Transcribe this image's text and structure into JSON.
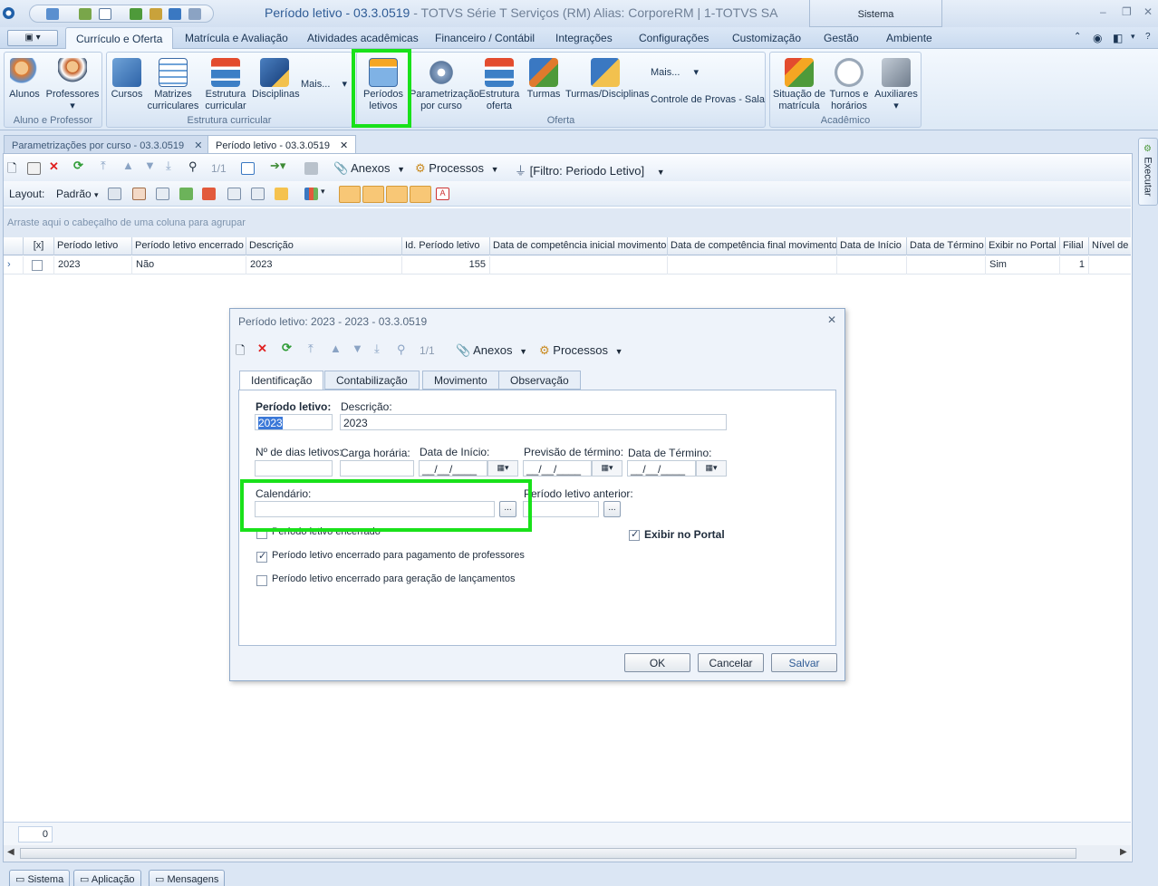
{
  "window": {
    "title": "Período letivo - 03.3.0519",
    "subtitle": " - TOTVS Série T Serviços (RM) Alias: CorporeRM | 1-TOTVS SA",
    "system_tab": "Sistema"
  },
  "menu": [
    "Currículo e Oferta",
    "Matrícula e Avaliação",
    "Atividades acadêmicas",
    "Financeiro / Contábil",
    "Integrações",
    "Configurações",
    "Customização",
    "Gestão",
    "Ambiente"
  ],
  "ribbon": {
    "groups": [
      "Aluno e Professor",
      "Estrutura curricular",
      "Oferta",
      "Acadêmico"
    ],
    "alunos": "Alunos",
    "professores": "Professores",
    "cursos": "Cursos",
    "matrizes": [
      "Matrizes",
      "curriculares"
    ],
    "estrutura": [
      "Estrutura",
      "curricular"
    ],
    "disciplinas": "Disciplinas",
    "mais1": "Mais...",
    "periodos": [
      "Períodos",
      "letivos"
    ],
    "parametrizacao": [
      "Parametrização",
      "por curso"
    ],
    "estrutura_oferta": [
      "Estrutura",
      "oferta"
    ],
    "turmas": "Turmas",
    "turmas_disciplinas": "Turmas/Disciplinas",
    "mais2": "Mais...",
    "controle": "Controle de Provas - Sala",
    "situacao": [
      "Situação de",
      "matrícula"
    ],
    "turnos": [
      "Turnos e",
      "horários"
    ],
    "auxiliares": "Auxiliares"
  },
  "doc_tabs": [
    "Parametrizações por curso - 03.3.0519",
    "Período letivo - 03.3.0519"
  ],
  "toolbar": {
    "nav_count": "1/1",
    "anexos": "Anexos",
    "processos": "Processos",
    "filter": "[Filtro: Periodo Letivo]",
    "layout_label": "Layout:",
    "layout_value": "Padrão"
  },
  "grid": {
    "group_hint": "Arraste aqui o cabeçalho de uma coluna para agrupar",
    "headers": [
      "[x]",
      "Período letivo",
      "Período letivo encerrado",
      "Descrição",
      "Id. Período letivo",
      "Data de competência inicial movimento",
      "Data de competência final movimento",
      "Data de Início",
      "Data de Término",
      "Exibir no Portal",
      "Filial",
      "Nível de"
    ],
    "row": {
      "periodo": "2023",
      "encerrado": "Não",
      "descricao": "2023",
      "id": "155",
      "exibir": "Sim",
      "filial": "1"
    },
    "footer_count": "0"
  },
  "exec_label": "Executar",
  "statusbar": [
    "Sistema",
    "Aplicação",
    "Mensagens"
  ],
  "dialog": {
    "title": "Período letivo: 2023 - 2023 - 03.3.0519",
    "nav_count": "1/1",
    "anexos": "Anexos",
    "processos": "Processos",
    "tabs": [
      "Identificação",
      "Contabilização",
      "Movimento",
      "Observação"
    ],
    "labels": {
      "periodo": "Período letivo:",
      "descricao": "Descrição:",
      "dias": "Nº de dias letivos:",
      "carga": "Carga horária:",
      "inicio": "Data de Início:",
      "previsao": "Previsão de término:",
      "termino": "Data de Término:",
      "calendario": "Calendário:",
      "anterior": "Período letivo anterior:",
      "encerrado": "Período letivo encerrado",
      "encerrado_pag": "Período letivo encerrado para pagamento de professores",
      "encerrado_lanc": "Período letivo encerrado para geração de lançamentos",
      "exibir": "Exibir no Portal"
    },
    "values": {
      "periodo": "2023",
      "descricao": "2023",
      "date_mask": "__/__/____"
    },
    "buttons": {
      "ok": "OK",
      "cancel": "Cancelar",
      "save": "Salvar"
    }
  }
}
